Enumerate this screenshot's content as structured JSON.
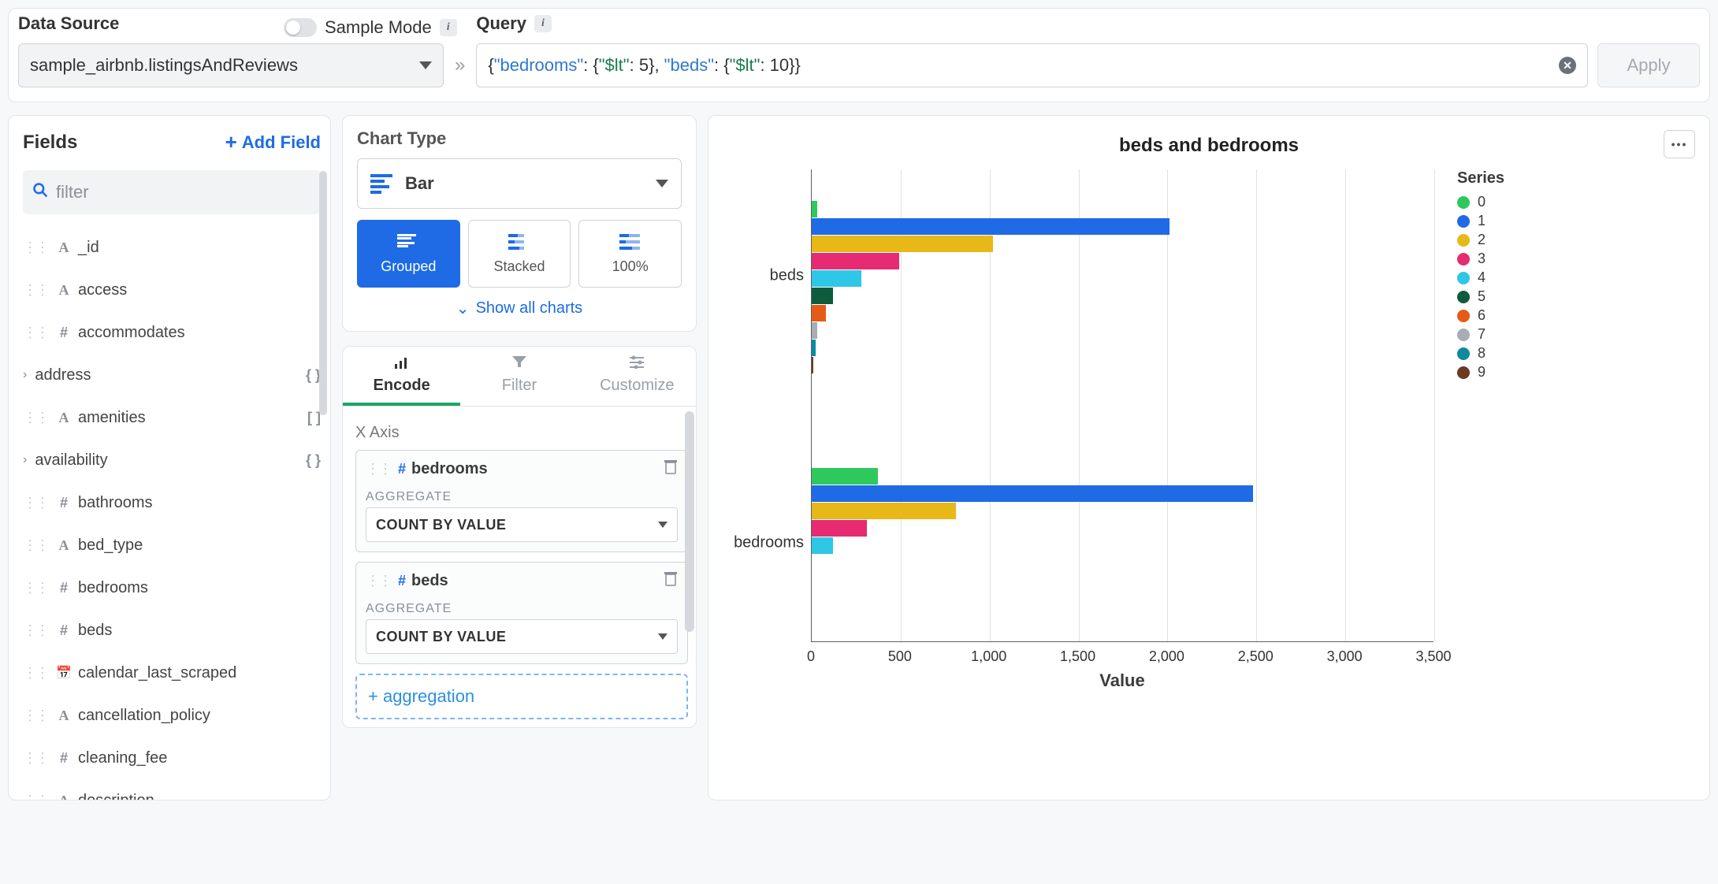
{
  "top": {
    "dataSourceLabel": "Data Source",
    "sampleModeLabel": "Sample Mode",
    "dataSourceValue": "sample_airbnb.listingsAndReviews",
    "queryLabel": "Query",
    "queryRaw": "{\"bedrooms\": {\"$lt\": 5}, \"beds\": {\"$lt\": 10}}",
    "applyLabel": "Apply"
  },
  "fields": {
    "title": "Fields",
    "addField": "Add Field",
    "filterPlaceholder": "filter",
    "items": [
      {
        "type": "A",
        "name": "_id"
      },
      {
        "type": "A",
        "name": "access"
      },
      {
        "type": "#",
        "name": "accommodates"
      },
      {
        "type": "obj",
        "name": "address",
        "expandable": true,
        "tail": "{ }"
      },
      {
        "type": "A",
        "name": "amenities",
        "tail": "[ ]"
      },
      {
        "type": "obj",
        "name": "availability",
        "expandable": true,
        "tail": "{ }"
      },
      {
        "type": "#",
        "name": "bathrooms"
      },
      {
        "type": "A",
        "name": "bed_type"
      },
      {
        "type": "#",
        "name": "bedrooms"
      },
      {
        "type": "#",
        "name": "beds"
      },
      {
        "type": "cal",
        "name": "calendar_last_scraped"
      },
      {
        "type": "A",
        "name": "cancellation_policy"
      },
      {
        "type": "#",
        "name": "cleaning_fee"
      },
      {
        "type": "A",
        "name": "description"
      }
    ]
  },
  "config": {
    "chartTypeLabel": "Chart Type",
    "chartType": "Bar",
    "subtypes": [
      "Grouped",
      "Stacked",
      "100%"
    ],
    "subtypeActive": "Grouped",
    "showAll": "Show all charts",
    "tabs": [
      "Encode",
      "Filter",
      "Customize"
    ],
    "tabActive": "Encode",
    "xAxisLabel": "X Axis",
    "aggregateLabel": "AGGREGATE",
    "drops": [
      {
        "type": "#",
        "name": "bedrooms",
        "aggregate": "COUNT BY VALUE"
      },
      {
        "type": "#",
        "name": "beds",
        "aggregate": "COUNT BY VALUE"
      }
    ],
    "addAggregation": "+ aggregation"
  },
  "chart_data": {
    "type": "bar",
    "orientation": "horizontal",
    "title": "beds and bedrooms",
    "xlabel": "Value",
    "xlim": [
      0,
      3500
    ],
    "xticks": [
      0,
      500,
      1000,
      1500,
      2000,
      2500,
      3000,
      3500
    ],
    "categories": [
      "beds",
      "bedrooms"
    ],
    "legendTitle": "Series",
    "series": [
      {
        "name": "0",
        "color": "#2ec95d",
        "values": [
          30,
          370
        ]
      },
      {
        "name": "1",
        "color": "#1e6be5",
        "values": [
          2010,
          2480
        ]
      },
      {
        "name": "2",
        "color": "#e7b818",
        "values": [
          1020,
          810
        ]
      },
      {
        "name": "3",
        "color": "#e62b72",
        "values": [
          490,
          310
        ]
      },
      {
        "name": "4",
        "color": "#2fc7e6",
        "values": [
          280,
          120
        ]
      },
      {
        "name": "5",
        "color": "#0e5b3e",
        "values": [
          120,
          0
        ]
      },
      {
        "name": "6",
        "color": "#e65a17",
        "values": [
          80,
          0
        ]
      },
      {
        "name": "7",
        "color": "#a7adb3",
        "values": [
          30,
          0
        ]
      },
      {
        "name": "8",
        "color": "#0e8aa0",
        "values": [
          20,
          0
        ]
      },
      {
        "name": "9",
        "color": "#6b3a1f",
        "values": [
          10,
          0
        ]
      }
    ]
  }
}
